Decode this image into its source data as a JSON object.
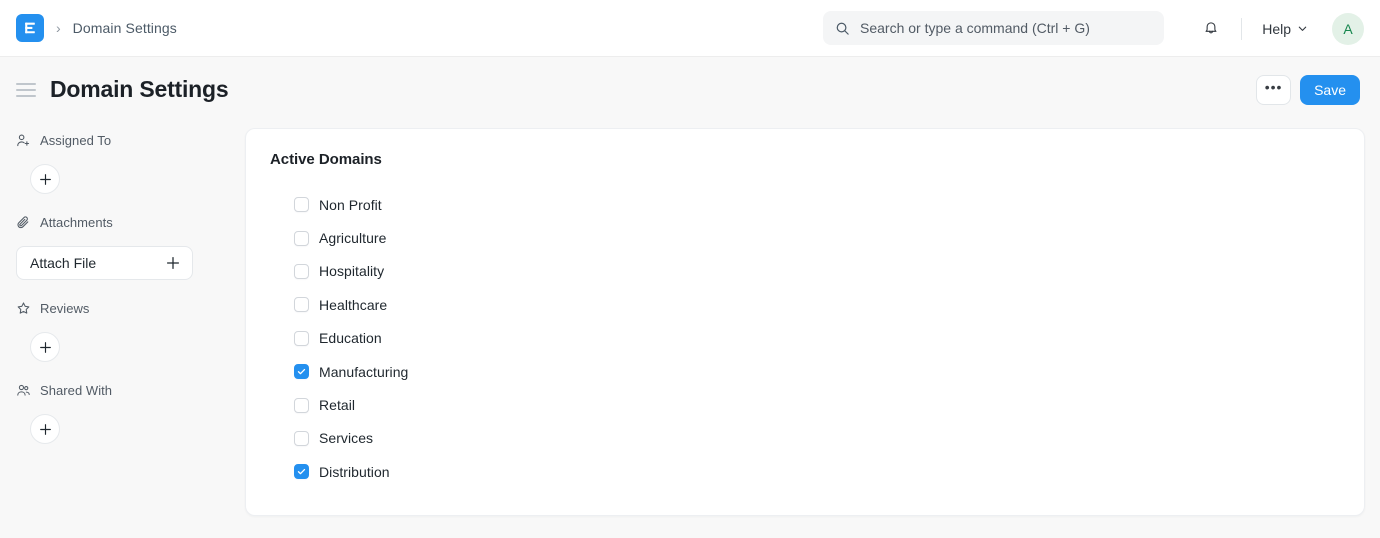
{
  "navbar": {
    "logo_icon": "erpnext-logo-icon",
    "logo_letter": "E",
    "breadcrumb_separator": "›",
    "breadcrumb": "Domain Settings",
    "search": {
      "icon": "search-icon",
      "placeholder": "Search or type a command (Ctrl + G)",
      "value": ""
    },
    "notifications_icon": "bell-icon",
    "help": {
      "label": "Help",
      "chevron_icon": "chevron-down-icon"
    },
    "avatar": {
      "initial": "A",
      "bg_color": "#E3F1E7",
      "text_color": "#17874E"
    }
  },
  "page_head": {
    "menu_icon": "hamburger-menu-icon",
    "title": "Domain Settings",
    "more_label": "•••",
    "save_label": "Save"
  },
  "sidebar": {
    "sections": [
      {
        "icon": "user-add-icon",
        "label": "Assigned To",
        "control": "plus-circle",
        "add_label": "+"
      },
      {
        "icon": "paperclip-icon",
        "label": "Attachments",
        "control": "attach-button",
        "button_label": "Attach File",
        "add_label": "+"
      },
      {
        "icon": "star-icon",
        "label": "Reviews",
        "control": "plus-circle",
        "add_label": "+"
      },
      {
        "icon": "users-icon",
        "label": "Shared With",
        "control": "plus-circle",
        "add_label": "+"
      }
    ]
  },
  "main": {
    "card_title": "Active Domains",
    "checkbox_accent": "#2490EF",
    "domains": [
      {
        "label": "Non Profit",
        "checked": false
      },
      {
        "label": "Agriculture",
        "checked": false
      },
      {
        "label": "Hospitality",
        "checked": false
      },
      {
        "label": "Healthcare",
        "checked": false
      },
      {
        "label": "Education",
        "checked": false
      },
      {
        "label": "Manufacturing",
        "checked": true
      },
      {
        "label": "Retail",
        "checked": false
      },
      {
        "label": "Services",
        "checked": false
      },
      {
        "label": "Distribution",
        "checked": true
      }
    ]
  },
  "theme": {
    "primary": "#2490EF",
    "page_bg": "#F8F8F8",
    "card_bg": "#FFFFFF"
  }
}
